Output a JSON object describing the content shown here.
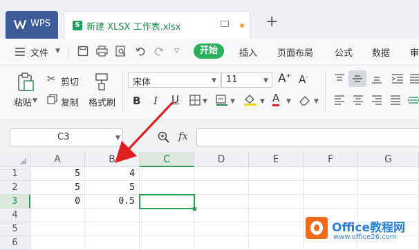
{
  "titlebar": {
    "wps_label": "WPS",
    "doc_title": "新建 XLSX 工作表.xlsx",
    "new_tab": "+"
  },
  "menu": {
    "file": "文件",
    "start": "开始",
    "items": [
      "插入",
      "页面布局",
      "公式",
      "数据",
      "审"
    ]
  },
  "ribbon": {
    "paste": "粘贴",
    "cut": "剪切",
    "copy": "复制",
    "format_painter": "格式刷",
    "font_name": "宋体",
    "font_size": "11",
    "bold": "B",
    "italic": "I",
    "underline": "U",
    "grow": "A",
    "shrink": "A",
    "font_color_label": "A"
  },
  "formula_bar": {
    "name_box": "C3",
    "fx": "fx"
  },
  "sheet": {
    "columns": [
      "A",
      "B",
      "C",
      "D",
      "E",
      "F",
      "G"
    ],
    "selected_column": "C",
    "rows": [
      "1",
      "2",
      "3",
      "4",
      "5",
      "6"
    ],
    "selected_row": "3",
    "cells": [
      [
        "5",
        "4"
      ],
      [
        "5",
        "5"
      ],
      [
        "0",
        "0.5"
      ]
    ]
  },
  "watermark": {
    "title": "Office教程网",
    "url": "www.office26.com"
  },
  "colors": {
    "accent_green": "#2bb15b",
    "wps_blue": "#3d5a99",
    "arrow_red": "#e02020"
  }
}
